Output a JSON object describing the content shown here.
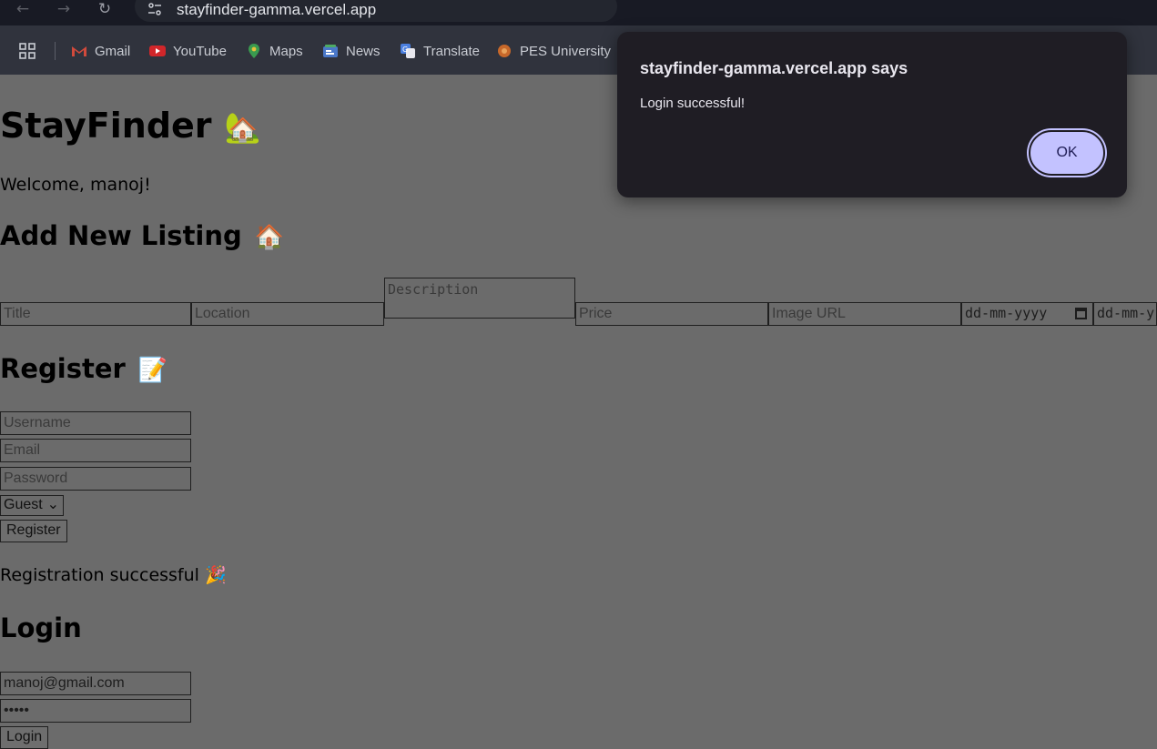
{
  "browser": {
    "url": "stayfinder-gamma.vercel.app",
    "bookmarks": [
      "Gmail",
      "YouTube",
      "Maps",
      "News",
      "Translate",
      "PES University"
    ]
  },
  "page": {
    "brand": "StayFinder",
    "brand_emoji": "🏡",
    "welcome": "Welcome, manoj!",
    "add_listing": {
      "heading": "Add New Listing",
      "emoji": "🏠",
      "title_placeholder": "Title",
      "location_placeholder": "Location",
      "description_placeholder": "Description",
      "price_placeholder": "Price",
      "image_placeholder": "Image URL",
      "date_from": "dd-mm-yyyy",
      "date_to": "dd-mm-y"
    },
    "register": {
      "heading": "Register",
      "emoji": "📝",
      "username_placeholder": "Username",
      "email_placeholder": "Email",
      "password_placeholder": "Password",
      "role": "Guest",
      "button": "Register",
      "status": "Registration successful 🎉"
    },
    "login": {
      "heading": "Login",
      "email_value": "manoj@gmail.com",
      "password_value": "•••••",
      "button": "Login"
    }
  },
  "dialog": {
    "title": "stayfinder-gamma.vercel.app says",
    "message": "Login successful!",
    "ok": "OK"
  }
}
